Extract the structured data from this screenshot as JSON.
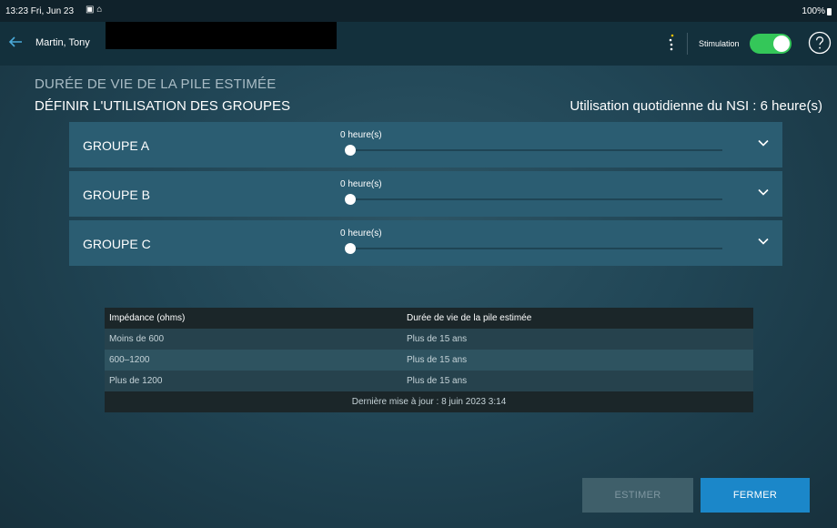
{
  "status_bar": {
    "time": "13:23  Fri, Jun 23",
    "battery": "100%"
  },
  "nav": {
    "patient_name": "Martin, Tony",
    "stimulation_label": "Stimulation",
    "stimulation_on": true
  },
  "page": {
    "title": "DURÉE DE VIE DE LA PILE ESTIMÉE",
    "subtitle": "DÉFINIR L'UTILISATION DES GROUPES",
    "daily_usage": "Utilisation quotidienne du NSI : 6 heure(s)"
  },
  "groups": [
    {
      "name": "GROUPE A",
      "hours_label": "0 heure(s)",
      "slider_value": 0
    },
    {
      "name": "GROUPE B",
      "hours_label": "0 heure(s)",
      "slider_value": 0
    },
    {
      "name": "GROUPE C",
      "hours_label": "0 heure(s)",
      "slider_value": 0
    }
  ],
  "table": {
    "headers": [
      "Impédance (ohms)",
      "Durée de vie de la pile estimée"
    ],
    "rows": [
      [
        "Moins de 600",
        "Plus de 15 ans"
      ],
      [
        "600–1200",
        "Plus de 15 ans"
      ],
      [
        "Plus de 1200",
        "Plus de 15 ans"
      ]
    ],
    "footer": "Dernière mise à jour : 8 juin 2023 3:14"
  },
  "buttons": {
    "estimate": "ESTIMER",
    "close": "FERMER"
  },
  "colors": {
    "accent": "#1b87c9",
    "toggle_on": "#34c759",
    "group_panel": "#2b5d72"
  }
}
